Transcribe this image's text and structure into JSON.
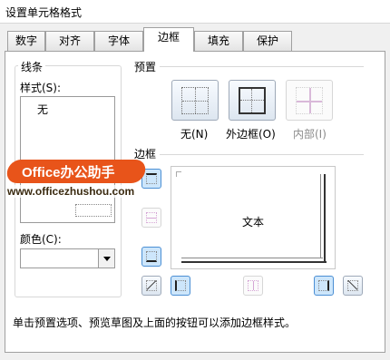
{
  "window": {
    "title": "设置单元格格式"
  },
  "tabs": [
    "数字",
    "对齐",
    "字体",
    "边框",
    "填充",
    "保护"
  ],
  "line_group": {
    "title": "线条",
    "style_label": "样式(S):",
    "style_none": "无",
    "color_label": "颜色(C):"
  },
  "presets": {
    "title": "预置",
    "none_label": "无(N)",
    "outline_label": "外边框(O)",
    "inside_label": "内部(I)"
  },
  "border": {
    "title": "边框",
    "preview_text": "文本"
  },
  "watermark": {
    "brand": "Office办公助手",
    "url": "www.officezhushou.com",
    "brand_color": "#e8541a"
  },
  "hint": "单击预置选项、预览草图及上面的按钮可以添加边框样式。"
}
